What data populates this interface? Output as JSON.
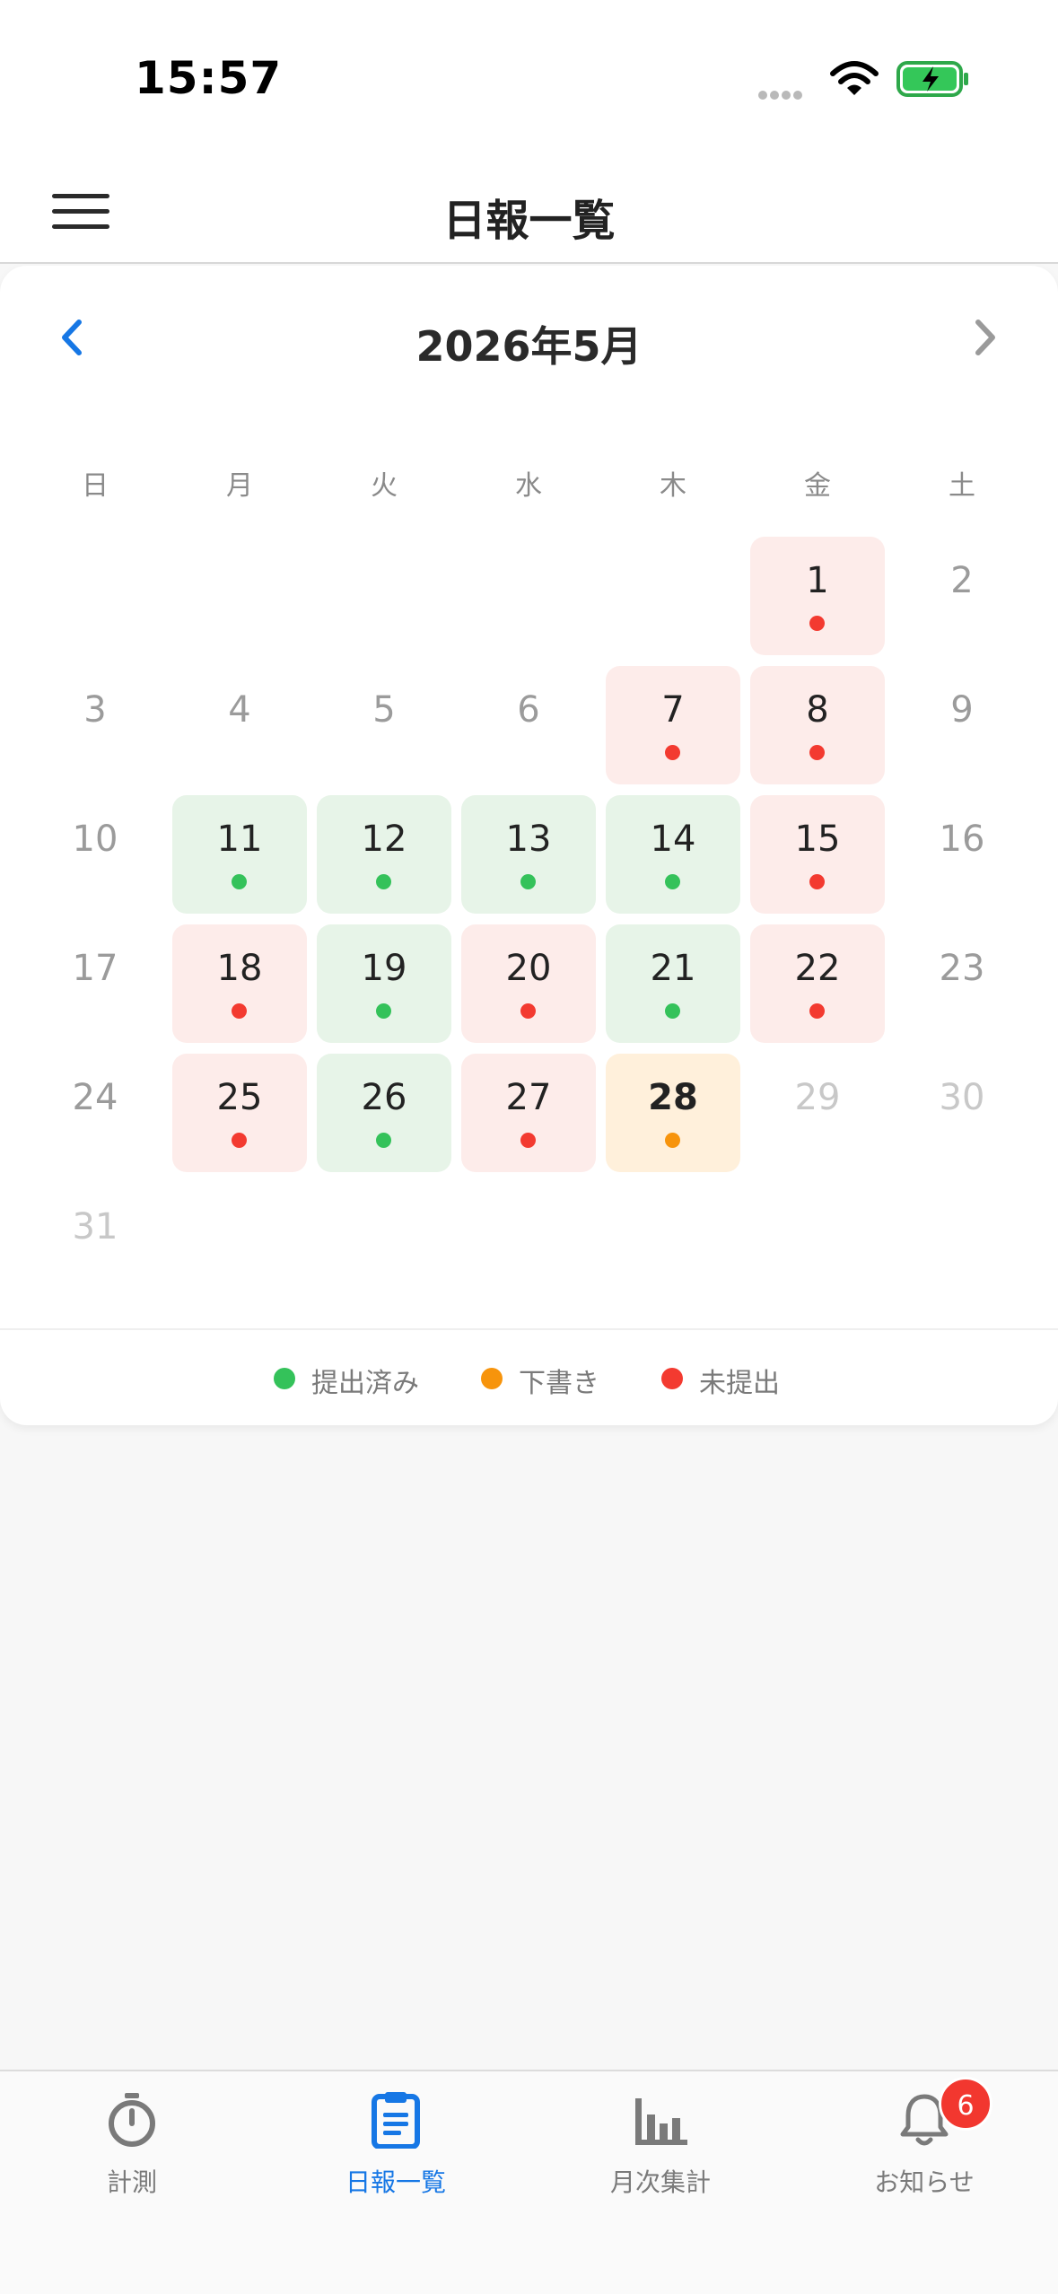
{
  "status_bar": {
    "time": "15:57"
  },
  "header": {
    "title": "日報一覧"
  },
  "calendar": {
    "month_title": "2026年5月",
    "weekdays": [
      "日",
      "月",
      "火",
      "水",
      "木",
      "金",
      "土"
    ],
    "status_colors": {
      "submitted": "#34c25a",
      "draft": "#f7940c",
      "unsubmitted": "#f33a30"
    },
    "days": [
      {
        "day": "1",
        "weekday": 5,
        "week": 0,
        "status": "unsubmitted"
      },
      {
        "day": "2",
        "weekday": 6,
        "week": 0,
        "status": "none"
      },
      {
        "day": "3",
        "weekday": 0,
        "week": 1,
        "status": "none"
      },
      {
        "day": "4",
        "weekday": 1,
        "week": 1,
        "status": "none"
      },
      {
        "day": "5",
        "weekday": 2,
        "week": 1,
        "status": "none"
      },
      {
        "day": "6",
        "weekday": 3,
        "week": 1,
        "status": "none"
      },
      {
        "day": "7",
        "weekday": 4,
        "week": 1,
        "status": "unsubmitted"
      },
      {
        "day": "8",
        "weekday": 5,
        "week": 1,
        "status": "unsubmitted"
      },
      {
        "day": "9",
        "weekday": 6,
        "week": 1,
        "status": "none"
      },
      {
        "day": "10",
        "weekday": 0,
        "week": 2,
        "status": "none"
      },
      {
        "day": "11",
        "weekday": 1,
        "week": 2,
        "status": "submitted"
      },
      {
        "day": "12",
        "weekday": 2,
        "week": 2,
        "status": "submitted"
      },
      {
        "day": "13",
        "weekday": 3,
        "week": 2,
        "status": "submitted"
      },
      {
        "day": "14",
        "weekday": 4,
        "week": 2,
        "status": "submitted"
      },
      {
        "day": "15",
        "weekday": 5,
        "week": 2,
        "status": "unsubmitted"
      },
      {
        "day": "16",
        "weekday": 6,
        "week": 2,
        "status": "none"
      },
      {
        "day": "17",
        "weekday": 0,
        "week": 3,
        "status": "none"
      },
      {
        "day": "18",
        "weekday": 1,
        "week": 3,
        "status": "unsubmitted"
      },
      {
        "day": "19",
        "weekday": 2,
        "week": 3,
        "status": "submitted"
      },
      {
        "day": "20",
        "weekday": 3,
        "week": 3,
        "status": "unsubmitted"
      },
      {
        "day": "21",
        "weekday": 4,
        "week": 3,
        "status": "submitted"
      },
      {
        "day": "22",
        "weekday": 5,
        "week": 3,
        "status": "unsubmitted"
      },
      {
        "day": "23",
        "weekday": 6,
        "week": 3,
        "status": "none"
      },
      {
        "day": "24",
        "weekday": 0,
        "week": 4,
        "status": "none"
      },
      {
        "day": "25",
        "weekday": 1,
        "week": 4,
        "status": "unsubmitted"
      },
      {
        "day": "26",
        "weekday": 2,
        "week": 4,
        "status": "submitted"
      },
      {
        "day": "27",
        "weekday": 3,
        "week": 4,
        "status": "unsubmitted"
      },
      {
        "day": "28",
        "weekday": 4,
        "week": 4,
        "status": "draft",
        "today": true
      },
      {
        "day": "29",
        "weekday": 5,
        "week": 4,
        "status": "future"
      },
      {
        "day": "30",
        "weekday": 6,
        "week": 4,
        "status": "future"
      },
      {
        "day": "31",
        "weekday": 0,
        "week": 5,
        "status": "future"
      }
    ]
  },
  "legend": [
    {
      "label": "提出済み",
      "color": "#34c25a"
    },
    {
      "label": "下書き",
      "color": "#f7940c"
    },
    {
      "label": "未提出",
      "color": "#f33a30"
    }
  ],
  "tabs": [
    {
      "label": "計測",
      "icon": "stopwatch-icon",
      "active": false
    },
    {
      "label": "日報一覧",
      "icon": "clipboard-icon",
      "active": true
    },
    {
      "label": "月次集計",
      "icon": "bar-chart-icon",
      "active": false
    },
    {
      "label": "お知らせ",
      "icon": "bell-icon",
      "active": false,
      "badge": "6"
    }
  ],
  "colors": {
    "accent": "#1677e5",
    "badge": "#f2372f"
  }
}
